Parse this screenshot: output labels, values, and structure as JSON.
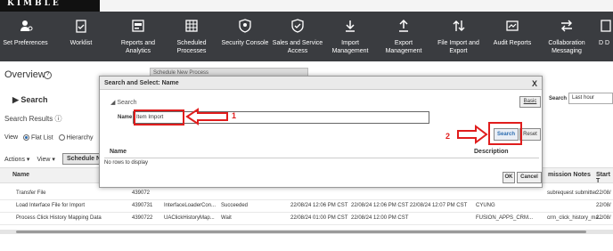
{
  "logo_text": "KIMBLE",
  "nav": {
    "items": [
      {
        "label": "Set Preferences",
        "icon": "user-settings-icon"
      },
      {
        "label": "Worklist",
        "icon": "clipboard-check-icon"
      },
      {
        "label": "Reports and Analytics",
        "icon": "report-icon"
      },
      {
        "label": "Scheduled Processes",
        "icon": "calendar-grid-icon"
      },
      {
        "label": "Security Console",
        "icon": "shield-icon"
      },
      {
        "label": "Sales and Service Access",
        "icon": "shield-check-icon"
      },
      {
        "label": "Import Management",
        "icon": "download-icon"
      },
      {
        "label": "Export Management",
        "icon": "upload-icon"
      },
      {
        "label": "File Import and Export",
        "icon": "up-down-arrows-icon"
      },
      {
        "label": "Audit Reports",
        "icon": "audit-icon"
      },
      {
        "label": "Collaboration Messaging",
        "icon": "swap-arrows-icon"
      },
      {
        "label": "D D",
        "icon": "document-icon"
      }
    ]
  },
  "page": {
    "title": "Overview",
    "search_label": "Search",
    "search_results_label": "Search Results",
    "view_label": "View",
    "flat_list_label": "Flat List",
    "hierarchy_label": "Hierarchy",
    "actions_label": "Actions",
    "view_menu_label": "View",
    "schedule_button": "Schedule Ne",
    "col_name": "Name",
    "schedule_panel_title": "Schedule New Process",
    "right_search_label": "Search",
    "right_search_value": "Last hour",
    "col_mission_notes": "mission Notes",
    "col_start": "Start T"
  },
  "rows": [
    {
      "name": "Transfer File",
      "id": "439072",
      "process": "",
      "status": "",
      "submitted": "",
      "completed": "",
      "user": "",
      "notes": "subrequest submitter",
      "start": "22/08/"
    },
    {
      "name": "Load Interface File for Import",
      "id": "4390731",
      "process": "InterfaceLoaderCon...",
      "status": "Succeeded",
      "submitted": "22/08/24 12:06 PM CST",
      "completed": "22/08/24 12:06 PM CST  22/08/24 12:07 PM CST",
      "user": "CYUNG",
      "notes": "",
      "start": "22/08/"
    },
    {
      "name": "Process Click History Mapping Data",
      "id": "4390722",
      "process": "UAClickHistoryMap...",
      "status": "Wait",
      "submitted": "22/08/24 01:00 PM CST",
      "completed": "22/08/24 12:00 PM CST",
      "user": "FUSION_APPS_CRM...",
      "notes": "crm_click_history_ma...",
      "start": "22/08/"
    }
  ],
  "dialog": {
    "title": "Search and Select: Name",
    "close_glyph": "X",
    "section_label": "Search",
    "basic_button": "Basic",
    "name_label": "Name",
    "name_value": "Item Import",
    "search_button": "Search",
    "reset_button": "Reset",
    "col_name": "Name",
    "col_description": "Description",
    "no_rows_text": "No rows to display",
    "ok_button": "OK",
    "cancel_button": "Cancel"
  },
  "annotations": {
    "step1": "1",
    "step2": "2",
    "color": "#e01d1d"
  },
  "colors": {
    "nav_bg": "#3a3c40",
    "accent": "#2c6cb0"
  }
}
